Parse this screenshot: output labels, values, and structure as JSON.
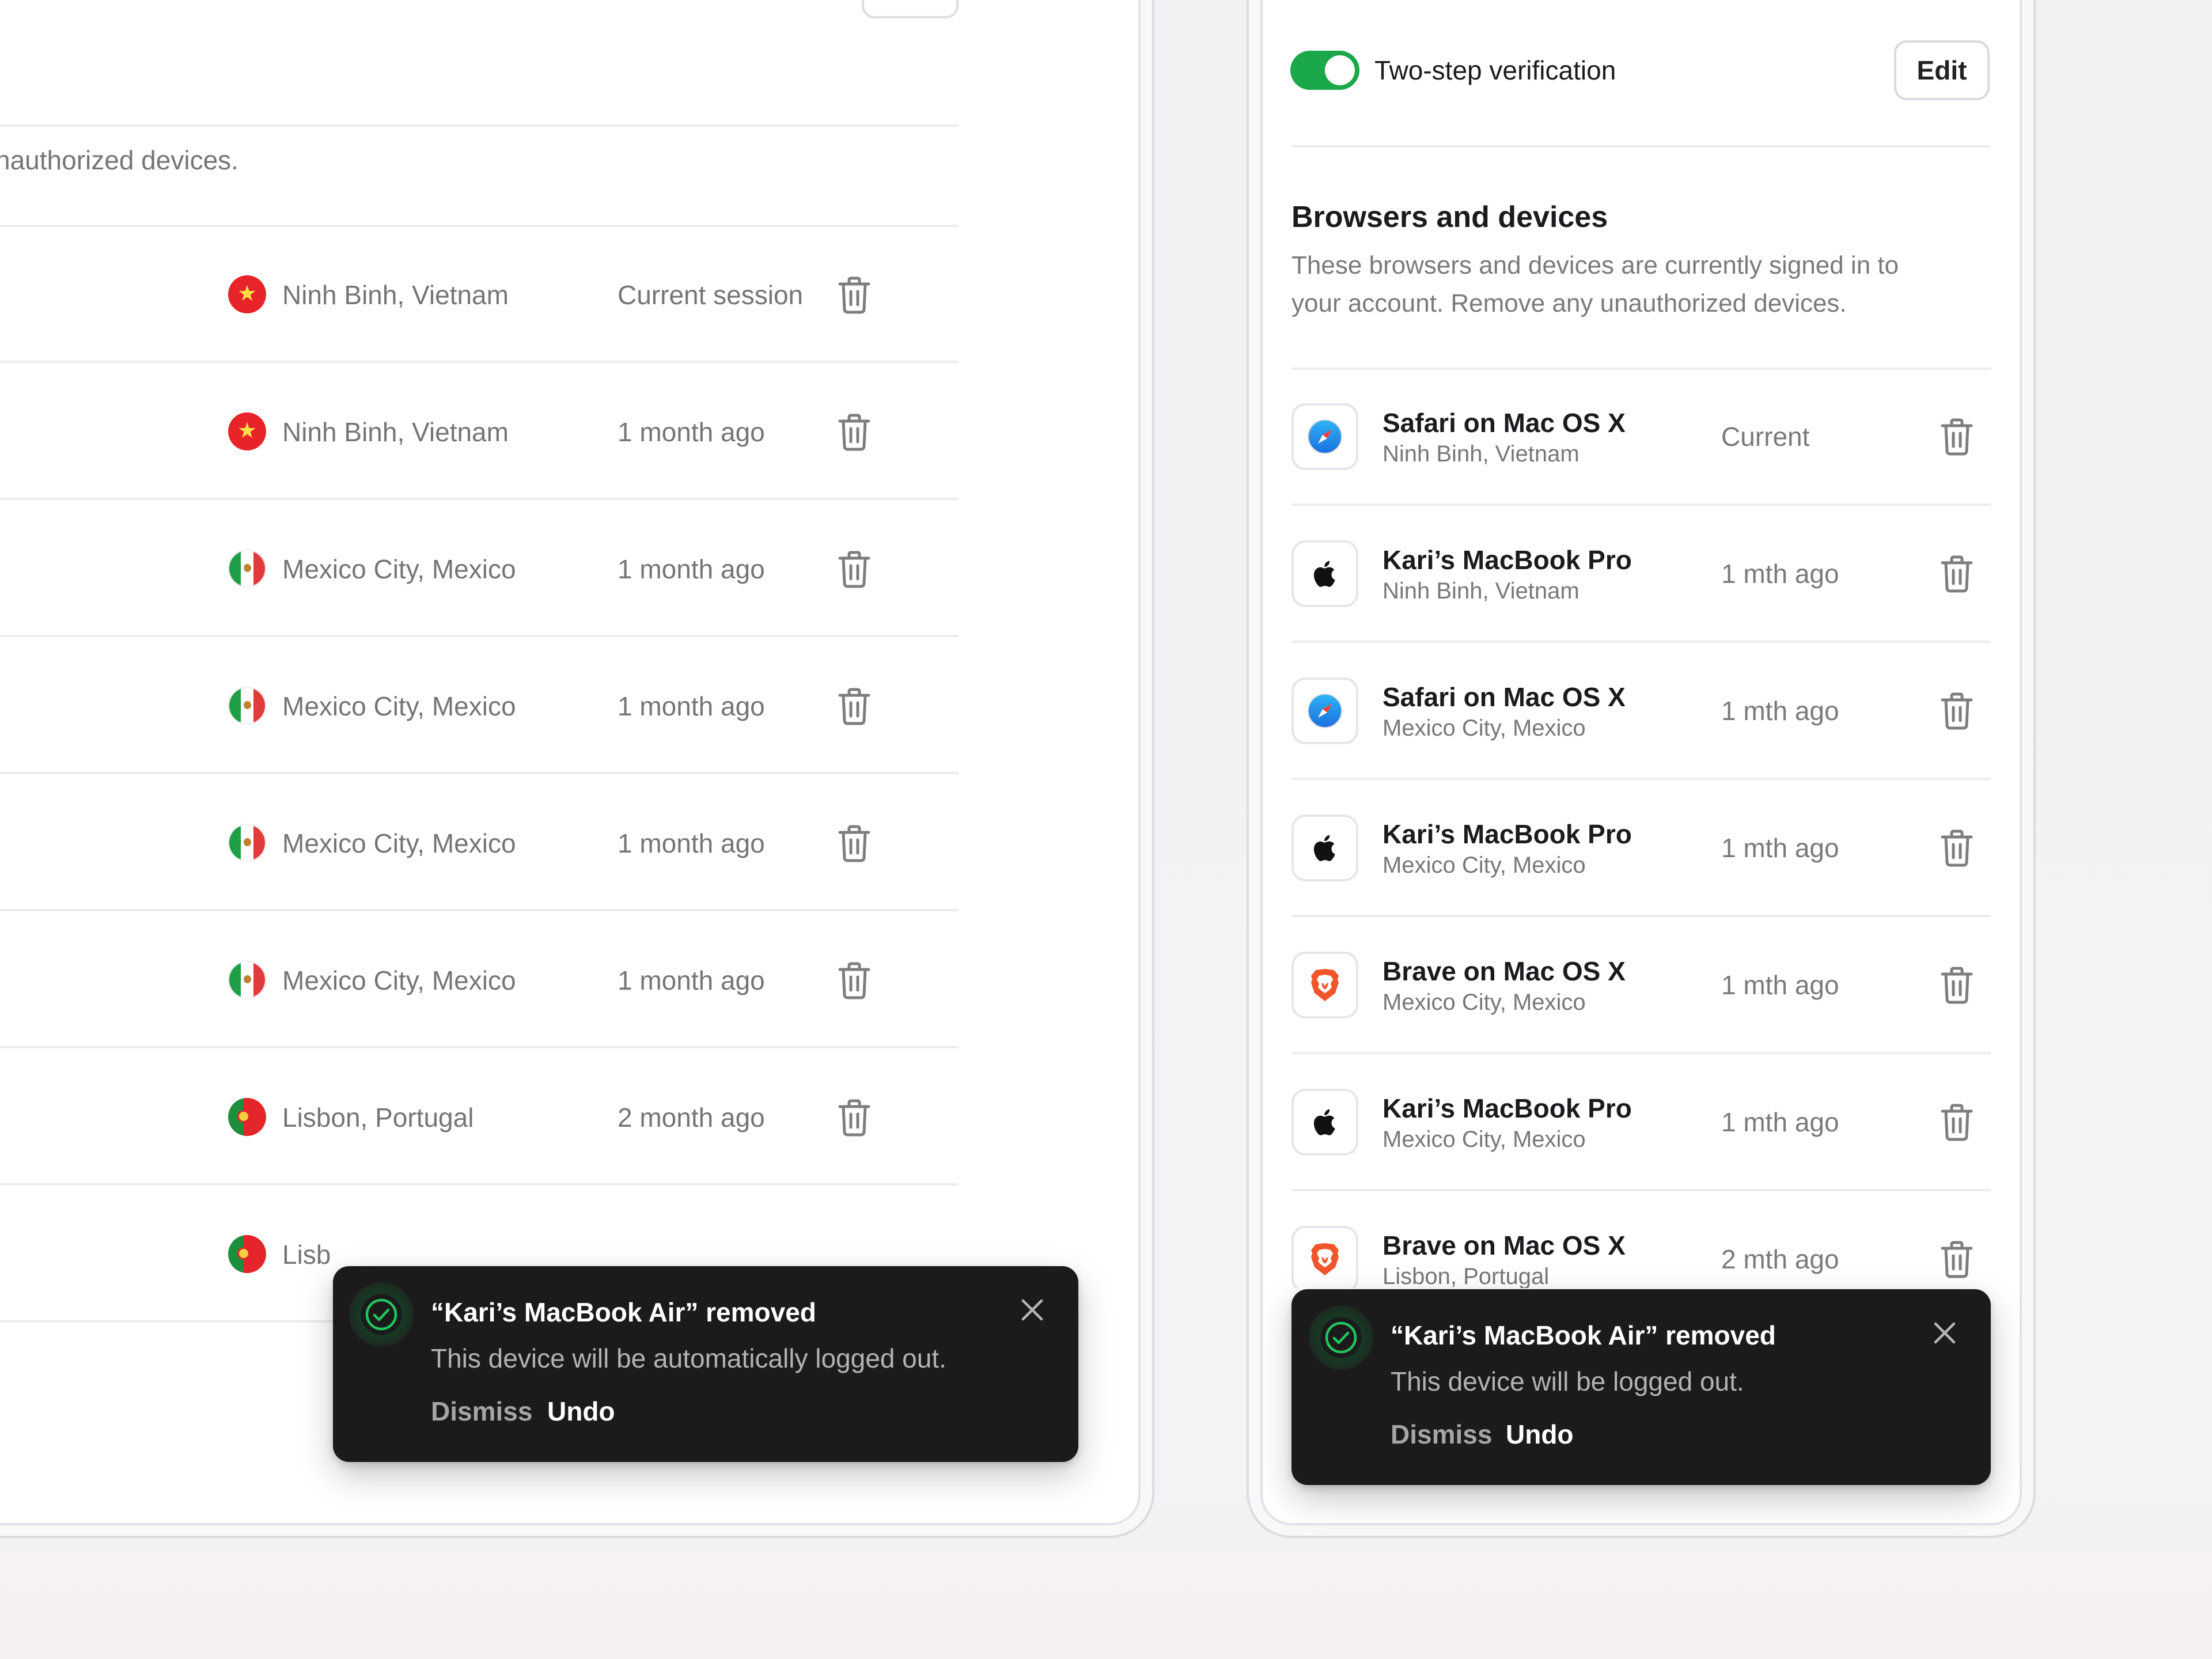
{
  "left_panel": {
    "description_fragment": "nauthorized devices.",
    "sessions": [
      {
        "location": "Ninh Binh, Vietnam",
        "flag": "vietnam-flag",
        "time": "Current session"
      },
      {
        "location": "Ninh Binh, Vietnam",
        "flag": "vietnam-flag",
        "time": "1 month ago"
      },
      {
        "location": "Mexico City, Mexico",
        "flag": "mexico-flag",
        "time": "1 month ago"
      },
      {
        "location": "Mexico City, Mexico",
        "flag": "mexico-flag",
        "time": "1 month ago"
      },
      {
        "location": "Mexico City, Mexico",
        "flag": "mexico-flag",
        "time": "1 month ago"
      },
      {
        "location": "Mexico City, Mexico",
        "flag": "mexico-flag",
        "time": "1 month ago"
      },
      {
        "location": "Lisbon, Portugal",
        "flag": "portugal-flag",
        "time": "2 month ago"
      },
      {
        "location": "Lisb",
        "flag": "portugal-flag",
        "time": ""
      }
    ],
    "toast": {
      "title": "“Kari’s MacBook Air” removed",
      "body": "This device will be automatically logged out.",
      "dismiss_label": "Dismiss",
      "undo_label": "Undo"
    }
  },
  "right_panel": {
    "two_step": {
      "label": "Two-step verification",
      "enabled": true,
      "edit_label": "Edit"
    },
    "section_title": "Browsers and devices",
    "section_description_line1": "These browsers and devices are currently signed in to",
    "section_description_line2": "your account. Remove any unauthorized devices.",
    "devices": [
      {
        "name": "Safari on Mac OS X",
        "location": "Ninh Binh, Vietnam",
        "time": "Current",
        "icon": "safari-icon"
      },
      {
        "name": "Kari’s MacBook Pro",
        "location": "Ninh Binh, Vietnam",
        "time": "1 mth ago",
        "icon": "apple-icon"
      },
      {
        "name": "Safari on Mac OS X",
        "location": "Mexico City, Mexico",
        "time": "1 mth ago",
        "icon": "safari-icon"
      },
      {
        "name": "Kari’s MacBook Pro",
        "location": "Mexico City, Mexico",
        "time": "1 mth ago",
        "icon": "apple-icon"
      },
      {
        "name": "Brave on Mac OS X",
        "location": "Mexico City, Mexico",
        "time": "1 mth ago",
        "icon": "brave-icon"
      },
      {
        "name": "Kari’s MacBook Pro",
        "location": "Mexico City, Mexico",
        "time": "1 mth ago",
        "icon": "apple-icon"
      },
      {
        "name": "Brave on Mac OS X",
        "location": "Lisbon, Portugal",
        "time": "2 mth ago",
        "icon": "brave-icon"
      }
    ],
    "toast": {
      "title": "“Kari’s MacBook Air” removed",
      "body": "This device will be logged out.",
      "dismiss_label": "Dismiss",
      "undo_label": "Undo"
    }
  },
  "colors": {
    "toggle_on": "#1aa84a",
    "toast_bg": "#1b1b1c",
    "check_green": "#22c55e"
  }
}
